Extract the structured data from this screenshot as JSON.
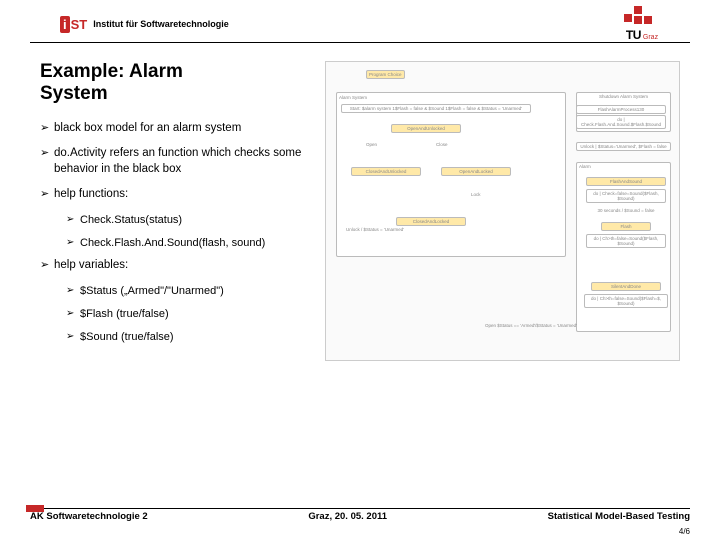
{
  "header": {
    "institut": "Institut für Softwaretechnologie",
    "logo_i": "i",
    "logo_st": "ST",
    "tu": "TU",
    "graz": "Graz"
  },
  "title_line1": "Example: Alarm",
  "title_line2": "System",
  "bullets": {
    "b1": "black box model for an alarm system",
    "b2": "do.Activity refers an function which checks some behavior in the black box",
    "b3": "help functions:",
    "b3a": "Check.Status(status)",
    "b3b": "Check.Flash.And.Sound(flash, sound)",
    "b4": "help variables:",
    "b4a": "$Status („Armed\"/\"Unarmed\")",
    "b4b": "$Flash (true/false)",
    "b4c": "$Sound (true/false)"
  },
  "diagram": {
    "top_label": "Program Choice",
    "state1": "Alarm System",
    "action1": "Start: $alarm system 1$Flash = false & $Sound 1$Flash = false & $Status = 'Unarmed'",
    "box_oau": "OpenAndUnlocked",
    "box_cau": "ClosedAndUnlocked",
    "box_oal": "OpenAndLocked",
    "box_cal": "ClosedAndLocked",
    "close": "Close",
    "open": "Open",
    "lock": "Lock",
    "unlock": "Unlock / $Status = 'Unarmed'",
    "shutdown": "Shutdown Alarm System",
    "flash_proc": "FlashAlarmProcess130",
    "check_flash": "do | Check.Flash.And.Sound.$Flash.$Sound",
    "unlock2": "Unlock | $Status='Unarmed', $Flash = false",
    "alarm": "Alarm",
    "flash_sound": "FlashAndSound",
    "do_check1": "do | Check=false=Sound($Flash, $Sound)",
    "thirty": "30 seconds / $Sound = false",
    "flash": "Flash",
    "do_check2": "do | Ch>th=false=Sound($Flash, $Sound)",
    "silent": "SilentAndDone",
    "do_check3": "do | Ch>th=false=Sound($Flash=$, $Sound)",
    "open_status": "Open $Status == 'Armed'/$Status = 'Unarmed'"
  },
  "footer": {
    "left": "AK Softwaretechnologie 2",
    "center": "Graz, 20. 05. 2011",
    "right": "Statistical Model-Based Testing",
    "page": "4/6"
  }
}
